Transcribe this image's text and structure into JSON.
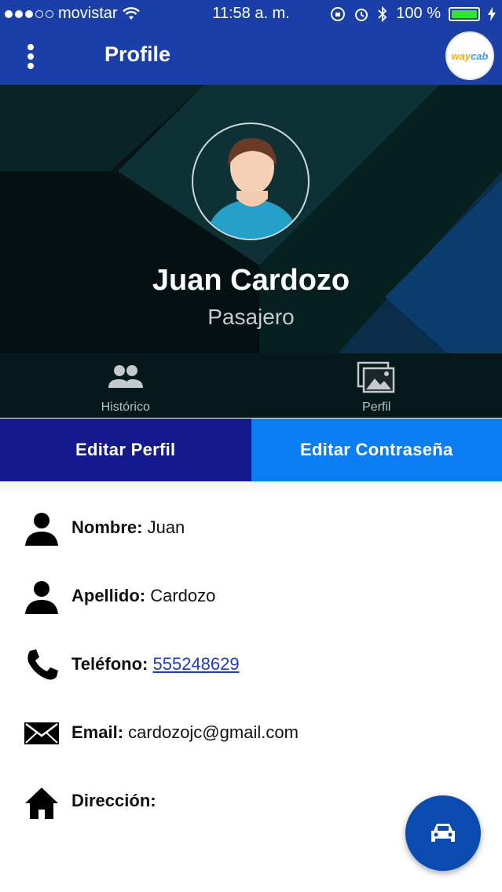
{
  "status_bar": {
    "carrier": "movistar",
    "time": "11:58 a. m.",
    "battery": "100 %",
    "battery_level": 1.0
  },
  "app_bar": {
    "title": "Profile",
    "menu_icon": "more-vert-icon",
    "logo_text": "way",
    "logo_text_2": "cab"
  },
  "profile": {
    "name": "Juan Cardozo",
    "role": "Pasajero"
  },
  "tabs": [
    {
      "label": "Histórico",
      "icon": "group-icon"
    },
    {
      "label": "Perfil",
      "icon": "photos-icon"
    }
  ],
  "actions": {
    "edit_profile": "Editar Perfil",
    "edit_password": "Editar Contraseña"
  },
  "info": {
    "name_label": "Nombre:",
    "name_value": "Juan",
    "surname_label": "Apellido:",
    "surname_value": "Cardozo",
    "phone_label": "Teléfono:",
    "phone_value": "555248629",
    "email_label": "Email:",
    "email_value": "cardozojc@gmail.com",
    "address_label": "Dirección:",
    "address_value": ""
  },
  "fab": {
    "icon": "car-icon"
  },
  "colors": {
    "primary": "#1a3fa8",
    "edit_profile_bg": "#14198e",
    "edit_password_bg": "#0a7ef2",
    "link": "#1d3bd1",
    "fab": "#0a4bb0"
  }
}
